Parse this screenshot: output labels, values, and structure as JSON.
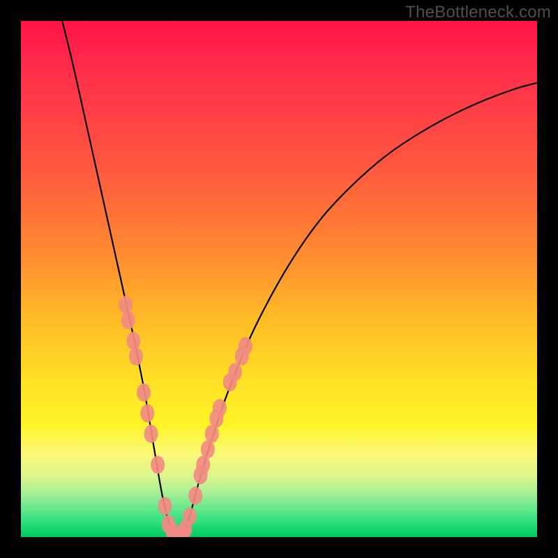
{
  "watermark": "TheBottleneck.com",
  "chart_data": {
    "type": "line",
    "title": "",
    "xlabel": "",
    "ylabel": "",
    "xlim": [
      0,
      100
    ],
    "ylim": [
      0,
      100
    ],
    "series": [
      {
        "name": "bottleneck-curve",
        "x": [
          8,
          10,
          12,
          14,
          16,
          18,
          20,
          22,
          23,
          24,
          25,
          26,
          27,
          28,
          29,
          30,
          31,
          32,
          33,
          34,
          36,
          38,
          40,
          44,
          48,
          52,
          56,
          60,
          66,
          72,
          80,
          88,
          96,
          100
        ],
        "y": [
          100,
          92,
          83,
          74,
          65,
          56,
          47,
          38,
          33,
          28,
          22,
          16,
          10,
          5,
          2,
          0,
          0,
          2,
          5,
          9,
          16,
          22,
          28,
          38,
          46,
          53,
          59,
          64,
          70,
          75,
          80,
          84,
          87,
          88
        ]
      }
    ],
    "markers": {
      "name": "highlighted-points",
      "color": "#f28b82",
      "points": [
        {
          "x": 20.3,
          "y": 45
        },
        {
          "x": 20.8,
          "y": 42
        },
        {
          "x": 21.8,
          "y": 38
        },
        {
          "x": 22.3,
          "y": 35
        },
        {
          "x": 23.8,
          "y": 28
        },
        {
          "x": 24.5,
          "y": 24
        },
        {
          "x": 25.2,
          "y": 20
        },
        {
          "x": 26.5,
          "y": 14
        },
        {
          "x": 27.9,
          "y": 6
        },
        {
          "x": 28.6,
          "y": 2.5
        },
        {
          "x": 29.4,
          "y": 1
        },
        {
          "x": 30.2,
          "y": 0
        },
        {
          "x": 31.2,
          "y": 0.5
        },
        {
          "x": 31.8,
          "y": 1.5
        },
        {
          "x": 32.7,
          "y": 4
        },
        {
          "x": 33.8,
          "y": 8
        },
        {
          "x": 34.8,
          "y": 12
        },
        {
          "x": 35.3,
          "y": 14
        },
        {
          "x": 36.2,
          "y": 17
        },
        {
          "x": 37.0,
          "y": 20
        },
        {
          "x": 37.9,
          "y": 23
        },
        {
          "x": 38.5,
          "y": 25
        },
        {
          "x": 40.5,
          "y": 30
        },
        {
          "x": 41.5,
          "y": 32
        },
        {
          "x": 42.8,
          "y": 35
        },
        {
          "x": 43.5,
          "y": 37
        }
      ]
    }
  }
}
